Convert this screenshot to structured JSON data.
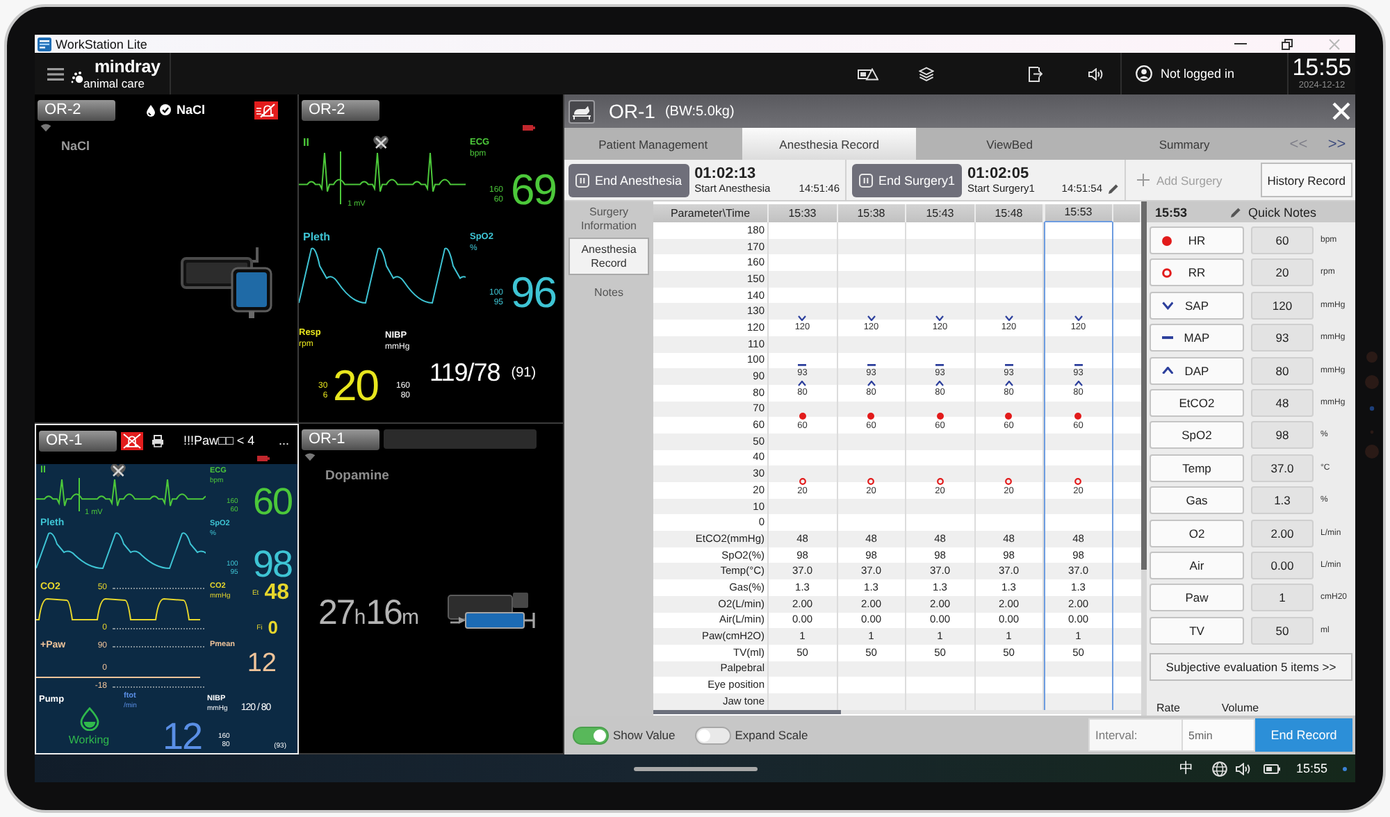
{
  "window": {
    "title": "WorkStation Lite"
  },
  "header": {
    "logo_name": "mindray",
    "logo_tagline": "animal care",
    "user": "Not logged in",
    "time": "15:55",
    "date": "2024-12-12"
  },
  "monitors": [
    {
      "bed": "OR-2",
      "kind": "pump",
      "selected": false,
      "alarm_off": true,
      "recording": false,
      "wifi": true,
      "battery_low": false,
      "message_bar": false,
      "header_drug": "NaCl",
      "drug": "NaCl"
    },
    {
      "bed": "OR-2",
      "kind": "vitals",
      "selected": false,
      "alarm_off": false,
      "recording": false,
      "wifi": false,
      "battery_low": true,
      "message_bar": false,
      "blocks": [
        {
          "kind": "ecg",
          "label": "II",
          "muted": true,
          "scale": "1 mV",
          "name": "ECG",
          "unit": "bpm",
          "limits": [
            "160",
            "60"
          ],
          "value": "69",
          "color": "#4cc83a"
        },
        {
          "kind": "pleth",
          "label": "Pleth",
          "name": "SpO2",
          "unit": "%",
          "limits": [
            "100",
            "95"
          ],
          "value": "96",
          "color": "#3ec4d4"
        },
        {
          "kind": "numerics",
          "items": [
            {
              "kind": "numeric",
              "name": "Resp",
              "unit": "rpm",
              "limits": [
                "30",
                "6"
              ],
              "value": "20",
              "color": "#e8e61e"
            },
            {
              "kind": "nibp",
              "name": "NIBP",
              "unit": "mmHg",
              "limits": [
                "160",
                "80"
              ],
              "value": "119/78",
              "mean": "(91)",
              "color": "#ffffff"
            }
          ]
        }
      ]
    },
    {
      "bed": "OR-1",
      "kind": "vitals",
      "selected": true,
      "alarm_off": true,
      "recording": true,
      "wifi": false,
      "battery_low": true,
      "message_bar": false,
      "alarm_message": "!!!Paw□□ < 4",
      "more": "...",
      "blocks": [
        {
          "kind": "ecg",
          "label": "II",
          "muted": true,
          "scale": "1 mV",
          "name": "ECG",
          "unit": "bpm",
          "limits": [
            "160",
            "60"
          ],
          "value": "60",
          "color": "#4cc83a"
        },
        {
          "kind": "pleth",
          "label": "Pleth",
          "name": "SpO2",
          "unit": "%",
          "limits": [
            "100",
            "95"
          ],
          "value": "98",
          "color": "#3ec4d4"
        },
        {
          "kind": "co2",
          "label": "CO2",
          "scale": [
            "50",
            "0"
          ],
          "name": "CO2",
          "unit": "mmHg",
          "readings": [
            {
              "tag": "Et",
              "value": "48"
            },
            {
              "tag": "Fi",
              "value": "0"
            }
          ],
          "color": "#e6d62c"
        },
        {
          "kind": "paw",
          "label": "+Paw",
          "scale": [
            "90",
            "0",
            "-18"
          ],
          "name": "Pmean",
          "value": "12",
          "color": "#f0c49a"
        },
        {
          "kind": "numerics",
          "items": [
            {
              "kind": "pump",
              "name": "Pump",
              "status": "Working",
              "color": "#2fb84c"
            },
            {
              "kind": "numeric",
              "name": "ftot",
              "unit": "/min",
              "value": "12",
              "color": "#5a8fe6"
            },
            {
              "kind": "nibp",
              "name": "NIBP",
              "unit": "mmHg",
              "limits": [
                "160",
                "80"
              ],
              "value": "120 / 80",
              "mean": "(93)",
              "color": "#ffffff"
            }
          ]
        }
      ]
    },
    {
      "bed": "OR-1",
      "kind": "syringe",
      "selected": false,
      "alarm_off": false,
      "recording": false,
      "wifi": true,
      "battery_low": false,
      "message_bar": true,
      "drug": "Dopamine",
      "remaining": "27$_{h}$16$_{m}$"
    }
  ],
  "record_panel": {
    "bed": "OR-1",
    "weight": "(BW:5.0kg)",
    "tabs": [
      {
        "label": "Patient Management",
        "selected": false
      },
      {
        "label": "Anesthesia Record",
        "selected": true
      },
      {
        "label": "ViewBed",
        "selected": false
      },
      {
        "label": "Summary",
        "selected": false
      }
    ],
    "prev_page": {
      "label": "<<",
      "disabled": true
    },
    "next_page": {
      "label": ">>",
      "disabled": false
    },
    "timers": [
      {
        "button": "End Anesthesia",
        "elapsed": "01:02:13",
        "event": "Start Anesthesia",
        "start": "14:51:46",
        "editable": false
      },
      {
        "button": "End Surgery1",
        "elapsed": "01:02:05",
        "event": "Start Surgery1",
        "start": "14:51:54",
        "editable": true
      }
    ],
    "add_surgery": {
      "label": "Add Surgery",
      "disabled": true
    },
    "history_button": "History Record",
    "side_tabs": [
      {
        "label": "Surgery Information",
        "selected": false
      },
      {
        "label": "Anesthesia Record",
        "selected": true
      },
      {
        "label": "Notes",
        "selected": false
      }
    ],
    "table": {
      "corner": "Parameter\\Time",
      "columns": [
        {
          "label": "15:33",
          "selected": false
        },
        {
          "label": "15:38",
          "selected": false
        },
        {
          "label": "15:43",
          "selected": false
        },
        {
          "label": "15:48",
          "selected": false
        },
        {
          "label": "15:53",
          "selected": true
        }
      ],
      "scale": [
        "180",
        "170",
        "160",
        "150",
        "140",
        "130",
        "120",
        "110",
        "100",
        "90",
        "80",
        "70",
        "60",
        "50",
        "40",
        "30",
        "20",
        "10",
        "0"
      ],
      "markers": [
        {
          "kind": "v",
          "values": [
            "120",
            "120",
            "120",
            "120",
            "120"
          ]
        },
        {
          "kind": "dash",
          "values": [
            "93",
            "93",
            "93",
            "93",
            "93"
          ]
        },
        {
          "kind": "caret",
          "values": [
            "80",
            "80",
            "80",
            "80",
            "80"
          ]
        },
        {
          "kind": "dot",
          "values": [
            "60",
            "60",
            "60",
            "60",
            "60"
          ]
        },
        {
          "kind": "ring",
          "values": [
            "20",
            "20",
            "20",
            "20",
            "20"
          ]
        }
      ],
      "rows": [
        {
          "label": "EtCO2(mmHg)",
          "values": [
            "48",
            "48",
            "48",
            "48",
            "48"
          ]
        },
        {
          "label": "SpO2(%)",
          "values": [
            "98",
            "98",
            "98",
            "98",
            "98"
          ]
        },
        {
          "label": "Temp(°C)",
          "values": [
            "37.0",
            "37.0",
            "37.0",
            "37.0",
            "37.0"
          ]
        },
        {
          "label": "Gas(%)",
          "values": [
            "1.3",
            "1.3",
            "1.3",
            "1.3",
            "1.3"
          ]
        },
        {
          "label": "O2(L/min)",
          "values": [
            "2.00",
            "2.00",
            "2.00",
            "2.00",
            "2.00"
          ]
        },
        {
          "label": "Air(L/min)",
          "values": [
            "0.00",
            "0.00",
            "0.00",
            "0.00",
            "0.00"
          ]
        },
        {
          "label": "Paw(cmH2O)",
          "values": [
            "1",
            "1",
            "1",
            "1",
            "1"
          ]
        },
        {
          "label": "TV(ml)",
          "values": [
            "50",
            "50",
            "50",
            "50",
            "50"
          ]
        },
        {
          "label": "Palpebral"
        },
        {
          "label": "Eye position"
        },
        {
          "label": "Jaw tone"
        }
      ]
    },
    "quick_notes": {
      "time": "15:53",
      "title": "Quick Notes",
      "items": [
        {
          "kind": "dot",
          "label": "HR",
          "value": "60",
          "unit": "bpm"
        },
        {
          "kind": "ring",
          "label": "RR",
          "value": "20",
          "unit": "rpm"
        },
        {
          "kind": "v",
          "label": "SAP",
          "value": "120",
          "unit": "mmHg"
        },
        {
          "kind": "dash",
          "label": "MAP",
          "value": "93",
          "unit": "mmHg"
        },
        {
          "kind": "caret",
          "label": "DAP",
          "value": "80",
          "unit": "mmHg"
        },
        {
          "kind": "plain",
          "label": "EtCO2",
          "value": "48",
          "unit": "mmHg"
        },
        {
          "kind": "plain",
          "label": "SpO2",
          "value": "98",
          "unit": "%"
        },
        {
          "kind": "plain",
          "label": "Temp",
          "value": "37.0",
          "unit": "°C"
        },
        {
          "kind": "plain",
          "label": "Gas",
          "value": "1.3",
          "unit": "%"
        },
        {
          "kind": "plain",
          "label": "O2",
          "value": "2.00",
          "unit": "L/min"
        },
        {
          "kind": "plain",
          "label": "Air",
          "value": "0.00",
          "unit": "L/min"
        },
        {
          "kind": "plain",
          "label": "Paw",
          "value": "1",
          "unit": "cmH20"
        },
        {
          "kind": "plain",
          "label": "TV",
          "value": "50",
          "unit": "ml"
        }
      ],
      "evaluation_button": "Subjective evaluation 5 items >>",
      "footer_labels": [
        "Rate",
        "Volume"
      ]
    },
    "show_value": {
      "label": "Show Value",
      "on": true
    },
    "expand_scale": {
      "label": "Expand Scale",
      "on": false
    },
    "interval": {
      "label": "Interval:",
      "value": "5min"
    },
    "end_record": "End Record"
  },
  "taskbar": {
    "input_method": "中",
    "time": "15:55"
  }
}
